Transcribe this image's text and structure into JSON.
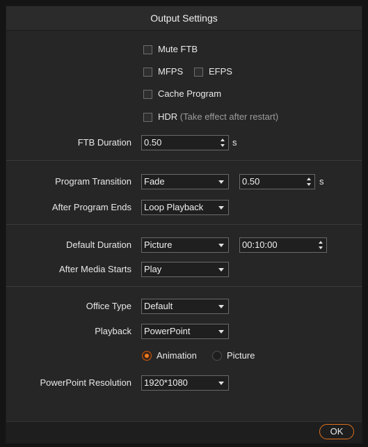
{
  "title": "Output Settings",
  "options": {
    "mute_ftb": "Mute FTB",
    "mfps": "MFPS",
    "efps": "EFPS",
    "cache_program": "Cache Program",
    "hdr": "HDR",
    "hdr_hint": "(Take effect after restart)"
  },
  "ftb": {
    "label": "FTB Duration",
    "value": "0.50",
    "unit": "s"
  },
  "program": {
    "transition_label": "Program Transition",
    "transition_value": "Fade",
    "transition_duration": "0.50",
    "unit": "s",
    "after_end_label": "After Program Ends",
    "after_end_value": "Loop Playback"
  },
  "media": {
    "default_duration_label": "Default Duration",
    "default_duration_type": "Picture",
    "default_duration_time": "00:10:00",
    "after_start_label": "After Media Starts",
    "after_start_value": "Play"
  },
  "office": {
    "type_label": "Office Type",
    "type_value": "Default",
    "playback_label": "Playback",
    "playback_value": "PowerPoint",
    "radio_animation": "Animation",
    "radio_picture": "Picture",
    "resolution_label": "PowerPoint Resolution",
    "resolution_value": "1920*1080"
  },
  "footer": {
    "ok": "OK"
  },
  "colors": {
    "accent": "#f07a20",
    "background": "#262626"
  }
}
